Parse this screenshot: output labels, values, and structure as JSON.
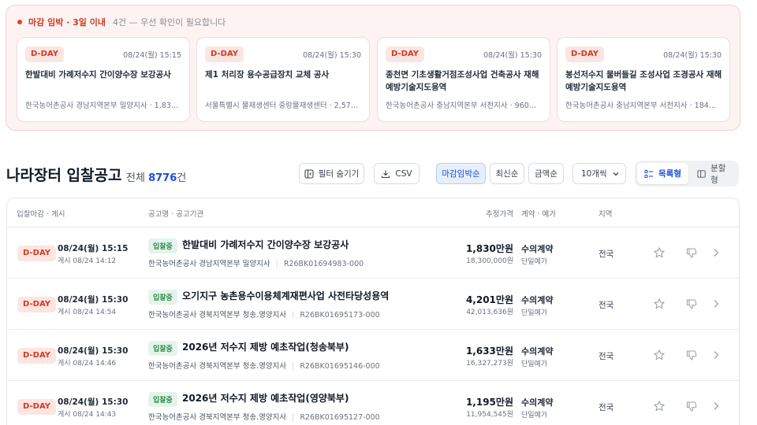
{
  "urgent": {
    "title": "마감 임박 · 3일 이내",
    "desc": "4건 — 우선 확인이 필요합니다",
    "cards": [
      {
        "badge": "D-DAY",
        "date": "08/24(월) 15:15",
        "title": "한발대비 가례저수지 간이양수장 보강공사",
        "org": "한국농어촌공사 경남지역본부 밀양지사 · 1,830…"
      },
      {
        "badge": "D-DAY",
        "date": "08/24(월) 15:30",
        "title": "제1 처리장 용수공급장치 교체 공사",
        "org": "서울특별시 물재생센터 중랑물재생센터 · 2,57…"
      },
      {
        "badge": "D-DAY",
        "date": "08/24(월) 15:30",
        "title": "종천면 기초생활거점조성사업 건축공사 재해예방기술지도용역",
        "org": "한국농어촌공사 충남지역본부 서천지사 · 960…"
      },
      {
        "badge": "D-DAY",
        "date": "08/24(월) 15:30",
        "title": "봉선저수지 물버들길 조성사업 조경공사 재해예방기술지도용역",
        "org": "한국농어촌공사 충남지역본부 서천지사 · 184…"
      }
    ]
  },
  "header": {
    "title": "나라장터 입찰공고",
    "total_label": "전체",
    "total_count": "8776",
    "total_unit": "건"
  },
  "toolbar": {
    "filter_hide": "필터 숨기기",
    "csv": "CSV",
    "sort_deadline": "마감임박순",
    "sort_latest": "최신순",
    "sort_amount": "금액순",
    "page_size": "10개씩",
    "view_list": "목록형",
    "view_split": "분할형"
  },
  "columns": {
    "deadline": "입찰마감 · 게시",
    "title": "공고명 · 공고기관",
    "price": "추정가격",
    "contract": "계약 · 예가",
    "region": "지역"
  },
  "rows": [
    {
      "badge": "D-DAY",
      "deadline": "08/24(월) 15:15",
      "posted": "게시 08/24 14:12",
      "status": "입찰중",
      "title": "한발대비 가례저수지 간이양수장 보강공사",
      "org": "한국농어촌공사 경남지역본부 밀양지사",
      "code": "R26BK01694983-000",
      "price": "1,830만원",
      "price_full": "18,300,000원",
      "contract": "수의계약",
      "contract_sub": "단일예가",
      "region": "전국"
    },
    {
      "badge": "D-DAY",
      "deadline": "08/24(월) 15:30",
      "posted": "게시 08/24 14:54",
      "status": "입찰중",
      "title": "오기지구 농촌용수이용체계재편사업 사전타당성용역",
      "org": "한국농어촌공사 경북지역본부 청송.영양지사",
      "code": "R26BK01695173-000",
      "price": "4,201만원",
      "price_full": "42,013,636원",
      "contract": "수의계약",
      "contract_sub": "단일예가",
      "region": "전국"
    },
    {
      "badge": "D-DAY",
      "deadline": "08/24(월) 15:30",
      "posted": "게시 08/24 14:46",
      "status": "입찰중",
      "title": "2026년 저수지 제방 예초작업(청송북부)",
      "org": "한국농어촌공사 경북지역본부 청송.영양지사",
      "code": "R26BK01695146-000",
      "price": "1,633만원",
      "price_full": "16,327,273원",
      "contract": "수의계약",
      "contract_sub": "단일예가",
      "region": "전국"
    },
    {
      "badge": "D-DAY",
      "deadline": "08/24(월) 15:30",
      "posted": "게시 08/24 14:43",
      "status": "입찰중",
      "title": "2026년 저수지 제방 예초작업(영양북부)",
      "org": "한국농어촌공사 경북지역본부 청송.영양지사",
      "code": "R26BK01695127-000",
      "price": "1,195만원",
      "price_full": "11,954,545원",
      "contract": "수의계약",
      "contract_sub": "단일예가",
      "region": "전국"
    }
  ],
  "colors": {
    "accent": "#1d4ed8",
    "danger": "#d03a22",
    "success": "#2e8b4d"
  }
}
